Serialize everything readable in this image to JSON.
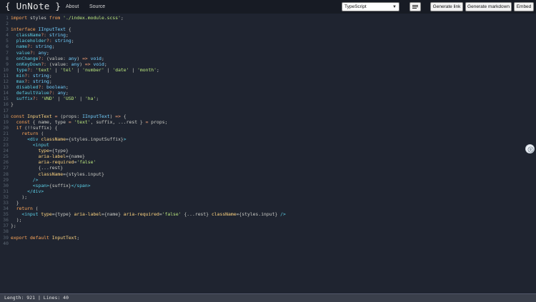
{
  "header": {
    "logo": "{ UnNote }",
    "nav": [
      "About",
      "Source"
    ],
    "language": "TypeScript",
    "buttons": {
      "generate_link": "Generate link",
      "generate_markdown": "Generate markdown",
      "embed": "Embed"
    }
  },
  "editor": {
    "line_count": 40,
    "lines": [
      [
        [
          "kw",
          "import"
        ],
        [
          "txt",
          " styles "
        ],
        [
          "kw",
          "from"
        ],
        [
          "txt",
          " "
        ],
        [
          "str",
          "'./index.module.scss'"
        ],
        [
          "txt",
          ";"
        ]
      ],
      [],
      [
        [
          "kw",
          "interface"
        ],
        [
          "txt",
          " "
        ],
        [
          "ty",
          "IInputText"
        ],
        [
          "txt",
          " {"
        ]
      ],
      [
        [
          "prop",
          "  className"
        ],
        [
          "op",
          "?:"
        ],
        [
          "txt",
          " "
        ],
        [
          "ty",
          "string"
        ],
        [
          "txt",
          ";"
        ]
      ],
      [
        [
          "prop",
          "  placeholder"
        ],
        [
          "op",
          "?:"
        ],
        [
          "txt",
          " "
        ],
        [
          "ty",
          "string"
        ],
        [
          "txt",
          ";"
        ]
      ],
      [
        [
          "prop",
          "  name"
        ],
        [
          "op",
          "?:"
        ],
        [
          "txt",
          " "
        ],
        [
          "ty",
          "string"
        ],
        [
          "txt",
          ";"
        ]
      ],
      [
        [
          "prop",
          "  value"
        ],
        [
          "op",
          "?:"
        ],
        [
          "txt",
          " "
        ],
        [
          "ty",
          "any"
        ],
        [
          "txt",
          ";"
        ]
      ],
      [
        [
          "prop",
          "  onChange"
        ],
        [
          "op",
          "?:"
        ],
        [
          "txt",
          " (value: "
        ],
        [
          "ty",
          "any"
        ],
        [
          "txt",
          ") "
        ],
        [
          "op",
          "=>"
        ],
        [
          "txt",
          " "
        ],
        [
          "ty",
          "void"
        ],
        [
          "txt",
          ";"
        ]
      ],
      [
        [
          "prop",
          "  onKeyDown"
        ],
        [
          "op",
          "?:"
        ],
        [
          "txt",
          " (value: "
        ],
        [
          "ty",
          "any"
        ],
        [
          "txt",
          ") "
        ],
        [
          "op",
          "=>"
        ],
        [
          "txt",
          " "
        ],
        [
          "ty",
          "void"
        ],
        [
          "txt",
          ";"
        ]
      ],
      [
        [
          "prop",
          "  type"
        ],
        [
          "op",
          "?:"
        ],
        [
          "txt",
          " "
        ],
        [
          "str",
          "'text'"
        ],
        [
          "txt",
          " | "
        ],
        [
          "str",
          "'tel'"
        ],
        [
          "txt",
          " | "
        ],
        [
          "str",
          "'number'"
        ],
        [
          "txt",
          " | "
        ],
        [
          "str",
          "'date'"
        ],
        [
          "txt",
          " | "
        ],
        [
          "str",
          "'month'"
        ],
        [
          "txt",
          ";"
        ]
      ],
      [
        [
          "prop",
          "  min"
        ],
        [
          "op",
          "?:"
        ],
        [
          "txt",
          " "
        ],
        [
          "ty",
          "string"
        ],
        [
          "txt",
          ";"
        ]
      ],
      [
        [
          "prop",
          "  max"
        ],
        [
          "op",
          "?:"
        ],
        [
          "txt",
          " "
        ],
        [
          "ty",
          "string"
        ],
        [
          "txt",
          ";"
        ]
      ],
      [
        [
          "prop",
          "  disabled"
        ],
        [
          "op",
          "?:"
        ],
        [
          "txt",
          " "
        ],
        [
          "ty",
          "boolean"
        ],
        [
          "txt",
          ";"
        ]
      ],
      [
        [
          "prop",
          "  defaultValue"
        ],
        [
          "op",
          "?:"
        ],
        [
          "txt",
          " "
        ],
        [
          "ty",
          "any"
        ],
        [
          "txt",
          ";"
        ]
      ],
      [
        [
          "prop",
          "  suffix"
        ],
        [
          "op",
          "?:"
        ],
        [
          "txt",
          " "
        ],
        [
          "str",
          "'VND'"
        ],
        [
          "txt",
          " | "
        ],
        [
          "str",
          "'USD'"
        ],
        [
          "txt",
          " | "
        ],
        [
          "str",
          "'ha'"
        ],
        [
          "txt",
          ";"
        ]
      ],
      [
        [
          "txt",
          "}"
        ]
      ],
      [],
      [
        [
          "kw",
          "const"
        ],
        [
          "txt",
          " "
        ],
        [
          "fn",
          "InputText"
        ],
        [
          "txt",
          " "
        ],
        [
          "op",
          "="
        ],
        [
          "txt",
          " (props: "
        ],
        [
          "ty",
          "IInputText"
        ],
        [
          "txt",
          ") "
        ],
        [
          "op",
          "=>"
        ],
        [
          "txt",
          " {"
        ]
      ],
      [
        [
          "txt",
          "  "
        ],
        [
          "kw",
          "const"
        ],
        [
          "txt",
          " { name, type "
        ],
        [
          "op",
          "="
        ],
        [
          "txt",
          " "
        ],
        [
          "str",
          "'text'"
        ],
        [
          "txt",
          ", suffix, ...rest } "
        ],
        [
          "op",
          "="
        ],
        [
          "txt",
          " props;"
        ]
      ],
      [
        [
          "txt",
          "  "
        ],
        [
          "kw",
          "if"
        ],
        [
          "txt",
          " (!!suffix) {"
        ]
      ],
      [
        [
          "txt",
          "    "
        ],
        [
          "kw",
          "return"
        ],
        [
          "txt",
          " ("
        ]
      ],
      [
        [
          "txt",
          "      "
        ],
        [
          "tag",
          "<div"
        ],
        [
          "txt",
          " "
        ],
        [
          "attr",
          "className"
        ],
        [
          "txt",
          "={styles.inputSuffix}"
        ],
        [
          "tag",
          ">"
        ]
      ],
      [
        [
          "txt",
          "        "
        ],
        [
          "tag",
          "<input"
        ]
      ],
      [
        [
          "txt",
          "          "
        ],
        [
          "attr",
          "type"
        ],
        [
          "txt",
          "={type}"
        ]
      ],
      [
        [
          "txt",
          "          "
        ],
        [
          "attr",
          "aria-label"
        ],
        [
          "txt",
          "={name}"
        ]
      ],
      [
        [
          "txt",
          "          "
        ],
        [
          "attr",
          "aria-required"
        ],
        [
          "txt",
          "="
        ],
        [
          "str",
          "'false'"
        ]
      ],
      [
        [
          "txt",
          "          {...rest}"
        ]
      ],
      [
        [
          "txt",
          "          "
        ],
        [
          "attr",
          "className"
        ],
        [
          "txt",
          "={styles.input}"
        ]
      ],
      [
        [
          "txt",
          "        "
        ],
        [
          "tag",
          "/>"
        ]
      ],
      [
        [
          "txt",
          "        "
        ],
        [
          "tag",
          "<span>"
        ],
        [
          "txt",
          "{suffix}"
        ],
        [
          "tag",
          "</span>"
        ]
      ],
      [
        [
          "txt",
          "      "
        ],
        [
          "tag",
          "</div>"
        ]
      ],
      [
        [
          "txt",
          "    );"
        ]
      ],
      [
        [
          "txt",
          "  }"
        ]
      ],
      [
        [
          "txt",
          "  "
        ],
        [
          "kw",
          "return"
        ],
        [
          "txt",
          " ("
        ]
      ],
      [
        [
          "txt",
          "    "
        ],
        [
          "tag",
          "<input"
        ],
        [
          "txt",
          " "
        ],
        [
          "attr",
          "type"
        ],
        [
          "txt",
          "={type} "
        ],
        [
          "attr",
          "aria-label"
        ],
        [
          "txt",
          "={name} "
        ],
        [
          "attr",
          "aria-required"
        ],
        [
          "txt",
          "="
        ],
        [
          "str",
          "'false'"
        ],
        [
          "txt",
          " {...rest} "
        ],
        [
          "attr",
          "className"
        ],
        [
          "txt",
          "={styles.input} "
        ],
        [
          "tag",
          "/>"
        ]
      ],
      [
        [
          "txt",
          "  );"
        ]
      ],
      [
        [
          "txt",
          "};"
        ]
      ],
      [],
      [
        [
          "kw",
          "export"
        ],
        [
          "txt",
          " "
        ],
        [
          "kw",
          "default"
        ],
        [
          "txt",
          " "
        ],
        [
          "fn",
          "InputText"
        ],
        [
          "txt",
          ";"
        ]
      ],
      []
    ]
  },
  "status": {
    "text": "Length: 921 | Lines: 40"
  },
  "colors": {
    "background": "#1f2430",
    "keyword": "#ffa759",
    "string": "#bae67e",
    "type": "#73d0ff"
  }
}
